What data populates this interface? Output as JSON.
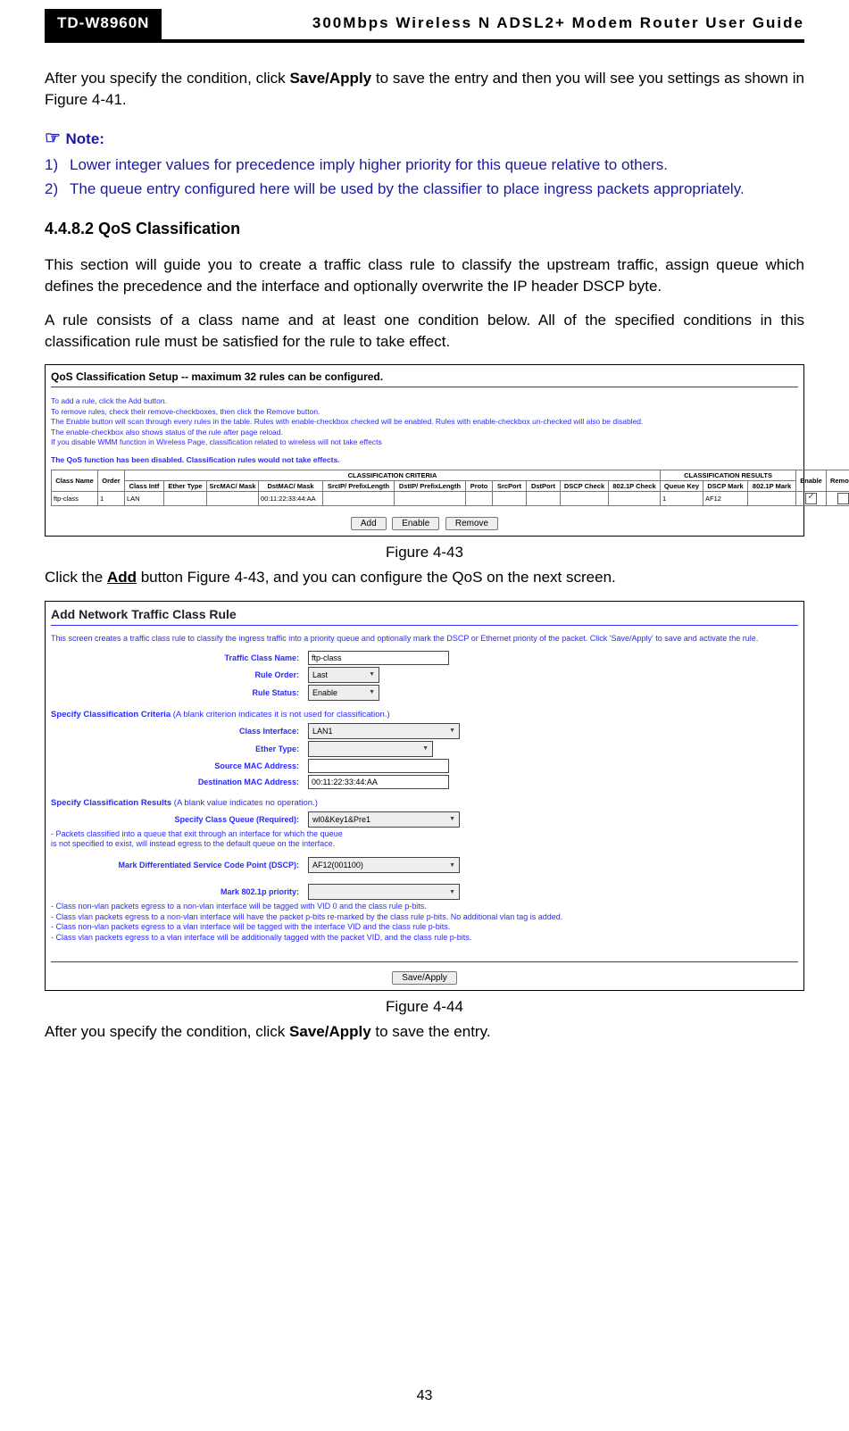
{
  "header": {
    "model": "TD-W8960N",
    "title": "300Mbps Wireless N ADSL2+ Modem Router User Guide"
  },
  "intro_before": "After you specify the condition, click ",
  "intro_bold": "Save/Apply",
  "intro_after": " to save the entry and then you will see you settings as shown in Figure 4-41.",
  "note_label": "Note:",
  "notes": [
    {
      "num": "1)",
      "text": "Lower integer values for precedence imply higher priority for this queue relative to others."
    },
    {
      "num": "2)",
      "text": "The queue entry configured here will be used by the classifier to place ingress packets appropriately."
    }
  ],
  "section": "4.4.8.2    QoS Classification",
  "para1": "This section will guide you to create a traffic class rule to classify the upstream traffic, assign queue which defines the precedence and the interface and optionally overwrite the IP header DSCP byte.",
  "para2": "A rule consists of a class name and at least one condition below. All of the specified conditions in this classification rule must be satisfied for the rule to take effect.",
  "fig43": {
    "title": "QoS Classification Setup -- maximum 32 rules can be configured.",
    "instructions": [
      "To add a rule, click the Add button.",
      "To remove rules, check their remove-checkboxes, then click the Remove button.",
      "The Enable button will scan through every rules in the table. Rules with enable-checkbox checked will be enabled. Rules with enable-checkbox un-checked will also be disabled.",
      "The enable-checkbox also shows status of the rule after page reload.",
      "If you disable WMM function in Wireless Page, classification related to wireless will not take effects"
    ],
    "warn": "The QoS function has been disabled. Classification rules would not take effects.",
    "group_crit": "CLASSIFICATION CRITERIA",
    "group_res": "CLASSIFICATION RESULTS",
    "cols": [
      "Class Name",
      "Order",
      "Class Intf",
      "Ether Type",
      "SrcMAC/ Mask",
      "DstMAC/ Mask",
      "SrcIP/ PrefixLength",
      "DstIP/ PrefixLength",
      "Proto",
      "SrcPort",
      "DstPort",
      "DSCP Check",
      "802.1P Check",
      "Queue Key",
      "DSCP Mark",
      "802.1P Mark",
      "Enable",
      "Remove"
    ],
    "row": {
      "class_name": "ftp-class",
      "order": "1",
      "class_intf": "LAN",
      "ether_type": "",
      "srcmac": "",
      "dstmac": "00:11:22:33:44:AA",
      "srcip": "",
      "dstip": "",
      "proto": "",
      "srcport": "",
      "dstport": "",
      "dscp_check": "",
      "p_check": "",
      "queue_key": "1",
      "dscp_mark": "AF12",
      "p_mark": ""
    },
    "btns": [
      "Add",
      "Enable",
      "Remove"
    ],
    "caption": "Figure 4-43"
  },
  "after43_a": "Click the ",
  "after43_b": "Add",
  "after43_c": " button Figure 4-43, and you can configure the QoS on the next screen.",
  "fig44": {
    "title": "Add Network Traffic Class Rule",
    "desc": "This screen creates a traffic class rule to classify the ingress traffic into a priority queue and optionally mark the DSCP or Ethernet priority of the packet. Click 'Save/Apply' to save and activate the rule.",
    "labels": {
      "tcn": "Traffic Class Name:",
      "ro": "Rule Order:",
      "rs": "Rule Status:",
      "ci": "Class Interface:",
      "et": "Ether Type:",
      "smac": "Source MAC Address:",
      "dmac": "Destination MAC Address:",
      "scq": "Specify Class Queue (Required):",
      "dscp": "Mark Differentiated Service Code Point (DSCP):",
      "p8021": "Mark 802.1p priority:"
    },
    "values": {
      "tcn": "ftp-class",
      "ro": "Last",
      "rs": "Enable",
      "ci": "LAN1",
      "et": "",
      "smac": "",
      "dmac": "00:11:22:33:44:AA",
      "scq": "wl0&Key1&Pre1",
      "dscp": "AF12(001100)",
      "p8021": ""
    },
    "sub1_a": "Specify Classification Criteria",
    "sub1_b": " (A blank criterion indicates it is not used for classification.)",
    "sub2_a": "Specify Classification Results",
    "sub2_b": " (A blank value indicates no operation.)",
    "note1": "- Packets classified into a queue that exit through an interface for which the queue",
    "note1b": "is not specified to exist, will instead egress to the default queue on the interface.",
    "notes2": [
      "- Class non-vlan packets egress to a non-vlan interface will be tagged with VID 0 and the class rule p-bits.",
      "- Class vlan packets egress to a non-vlan interface will have the packet p-bits re-marked by the class rule p-bits. No additional vlan tag is added.",
      "- Class non-vlan packets egress to a vlan interface will be tagged with the interface VID and the class rule p-bits.",
      "- Class vlan packets egress to a vlan interface will be additionally tagged with the packet VID, and the class rule p-bits."
    ],
    "btn": "Save/Apply",
    "caption": "Figure 4-44"
  },
  "closing_a": "After you specify the condition, click ",
  "closing_b": "Save/Apply",
  "closing_c": " to save the entry.",
  "page_num": "43"
}
